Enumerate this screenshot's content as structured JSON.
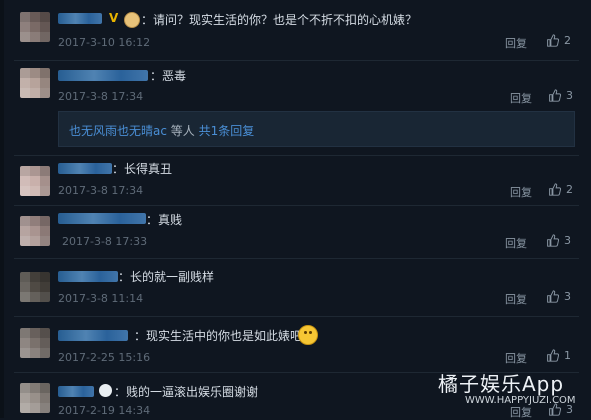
{
  "comments": [
    {
      "text": "请问？现实生活的你？也是个不折不扣的心机婊？",
      "date": "2017-3-10 16:12",
      "reply": "回复",
      "likes": "2"
    },
    {
      "text": "恶毒",
      "date": "2017-3-8 17:34",
      "reply": "回复",
      "likes": "3"
    },
    {
      "text": "长得真丑",
      "date": "2017-3-8 17:34",
      "reply": "回复",
      "likes": "2"
    },
    {
      "text": "真贱",
      "date": "2017-3-8 17:33",
      "reply": "回复",
      "likes": "3"
    },
    {
      "text": "长的就一副贱样",
      "date": "2017-3-8 11:14",
      "reply": "回复",
      "likes": "3"
    },
    {
      "text": "现实生活中的你也是如此婊吧",
      "date": "2017-2-25 15:16",
      "reply": "回复",
      "likes": "1"
    },
    {
      "text": "贱的一逼滚出娱乐圈谢谢",
      "date": "2017-2-19 14:34",
      "reply": "回复",
      "likes": "3"
    }
  ],
  "reply_box": {
    "names": "也无风雨也无晴ac",
    "mid": " 等人 ",
    "count": "共1条回复"
  },
  "badge": "V",
  "colon": "：",
  "watermark": {
    "title": "橘子娱乐App",
    "sub": "WWW.HAPPYJUZI.COM"
  }
}
